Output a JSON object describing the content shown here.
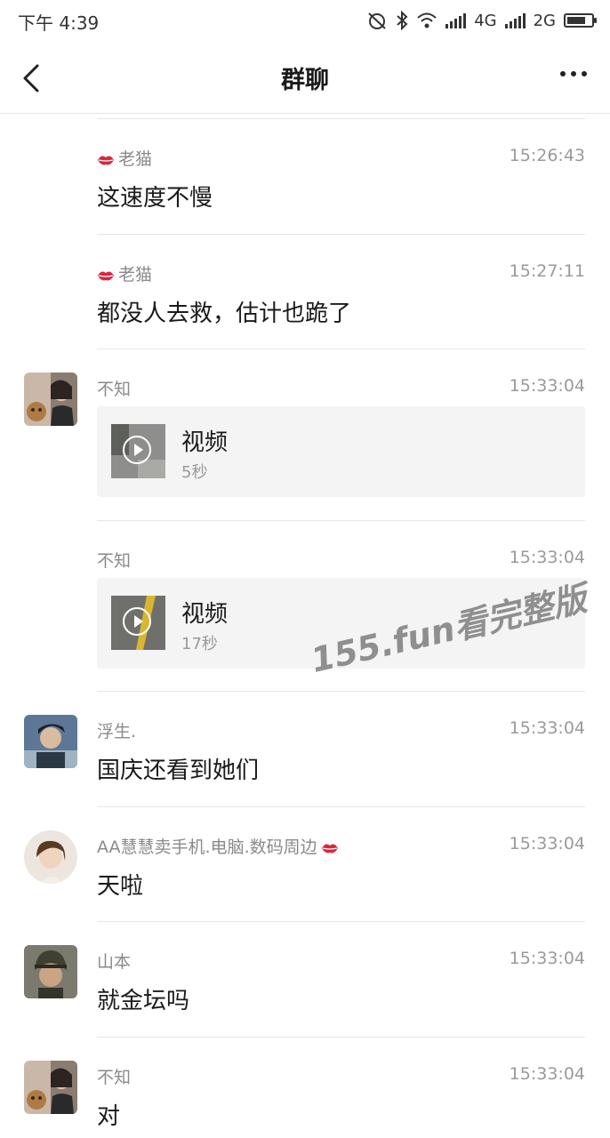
{
  "status_bar": {
    "time": "下午 4:39",
    "network_1": "4G",
    "network_2": "2G"
  },
  "nav": {
    "title": "群聊"
  },
  "messages": [
    {
      "name": "老猫",
      "time": "15:26:43",
      "text": "这速度不慢"
    },
    {
      "name": "老猫",
      "time": "15:27:11",
      "text": "都没人去救，估计也跪了"
    },
    {
      "name": "不知",
      "time": "15:33:04",
      "video_title": "视频",
      "video_duration": "5秒"
    },
    {
      "name": "不知",
      "time": "15:33:04",
      "video_title": "视频",
      "video_duration": "17秒"
    },
    {
      "name": "浮生.",
      "time": "15:33:04",
      "text": "国庆还看到她们"
    },
    {
      "name": "AA慧慧卖手机.电脑.数码周边",
      "time": "15:33:04",
      "text": "天啦"
    },
    {
      "name": "山本",
      "time": "15:33:04",
      "text": "就金坛吗"
    },
    {
      "name": "不知",
      "time": "15:33:04",
      "text": "对"
    }
  ],
  "watermark": "155.fun看完整版",
  "colors": {
    "lips": "#d8283e",
    "separator": "#e6e6e6",
    "card_bg": "#f4f4f4"
  }
}
